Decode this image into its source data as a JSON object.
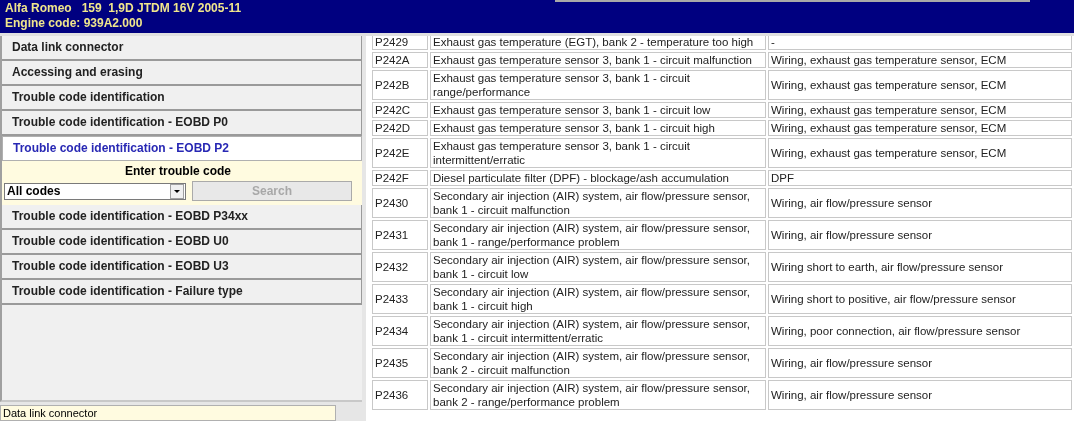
{
  "header": {
    "vehicle": "Alfa Romeo   159  1,9D JTDM 16V 2005-11",
    "engine": "Engine code: 939A2.000"
  },
  "sidebar": {
    "items": [
      {
        "label": "Data link connector",
        "selected": false
      },
      {
        "label": "Accessing and erasing",
        "selected": false
      },
      {
        "label": "Trouble code identification",
        "selected": false
      },
      {
        "label": "Trouble code identification - EOBD P0",
        "selected": false
      },
      {
        "label": "Trouble code identification - EOBD P2",
        "selected": true
      },
      {
        "label": "Trouble code identification - EOBD P34xx",
        "selected": false
      },
      {
        "label": "Trouble code identification - EOBD U0",
        "selected": false
      },
      {
        "label": "Trouble code identification - EOBD U3",
        "selected": false
      },
      {
        "label": "Trouble code identification - Failure type",
        "selected": false
      }
    ],
    "search_panel": {
      "title": "Enter trouble code",
      "dropdown": "All codes",
      "button": "Search",
      "button_disabled": true
    },
    "status": "Data link connector"
  },
  "table": {
    "rows": [
      {
        "code": "P2429",
        "description": "Exhaust gas temperature (EGT), bank 2 - temperature too high",
        "cause": "-"
      },
      {
        "code": "P242A",
        "description": "Exhaust gas temperature sensor 3, bank 1 - circuit malfunction",
        "cause": "Wiring, exhaust gas temperature sensor, ECM"
      },
      {
        "code": "P242B",
        "description": "Exhaust gas temperature sensor 3, bank 1 - circuit range/performance",
        "cause": "Wiring, exhaust gas temperature sensor, ECM"
      },
      {
        "code": "P242C",
        "description": "Exhaust gas temperature sensor 3, bank 1 - circuit low",
        "cause": "Wiring, exhaust gas temperature sensor, ECM"
      },
      {
        "code": "P242D",
        "description": "Exhaust gas temperature sensor 3, bank 1 - circuit high",
        "cause": "Wiring, exhaust gas temperature sensor, ECM"
      },
      {
        "code": "P242E",
        "description": "Exhaust gas temperature sensor 3, bank 1 - circuit intermittent/erratic",
        "cause": "Wiring, exhaust gas temperature sensor, ECM"
      },
      {
        "code": "P242F",
        "description": "Diesel particulate filter (DPF) - blockage/ash accumulation",
        "cause": "DPF"
      },
      {
        "code": "P2430",
        "description": "Secondary air injection (AIR) system, air flow/pressure sensor, bank 1 - circuit malfunction",
        "cause": "Wiring, air flow/pressure sensor"
      },
      {
        "code": "P2431",
        "description": "Secondary air injection (AIR) system, air flow/pressure sensor, bank 1 - range/performance problem",
        "cause": "Wiring, air flow/pressure sensor"
      },
      {
        "code": "P2432",
        "description": "Secondary air injection (AIR) system, air flow/pressure sensor, bank 1 - circuit low",
        "cause": "Wiring short to earth, air flow/pressure sensor"
      },
      {
        "code": "P2433",
        "description": "Secondary air injection (AIR) system, air flow/pressure sensor, bank 1 - circuit high",
        "cause": "Wiring short to positive, air flow/pressure sensor"
      },
      {
        "code": "P2434",
        "description": "Secondary air injection (AIR) system, air flow/pressure sensor, bank 1 - circuit intermittent/erratic",
        "cause": "Wiring, poor connection, air flow/pressure sensor"
      },
      {
        "code": "P2435",
        "description": "Secondary air injection (AIR) system, air flow/pressure sensor, bank 2 - circuit malfunction",
        "cause": "Wiring, air flow/pressure sensor"
      },
      {
        "code": "P2436",
        "description": "Secondary air injection (AIR) system, air flow/pressure sensor, bank 2 - range/performance problem",
        "cause": "Wiring, air flow/pressure sensor"
      }
    ]
  }
}
